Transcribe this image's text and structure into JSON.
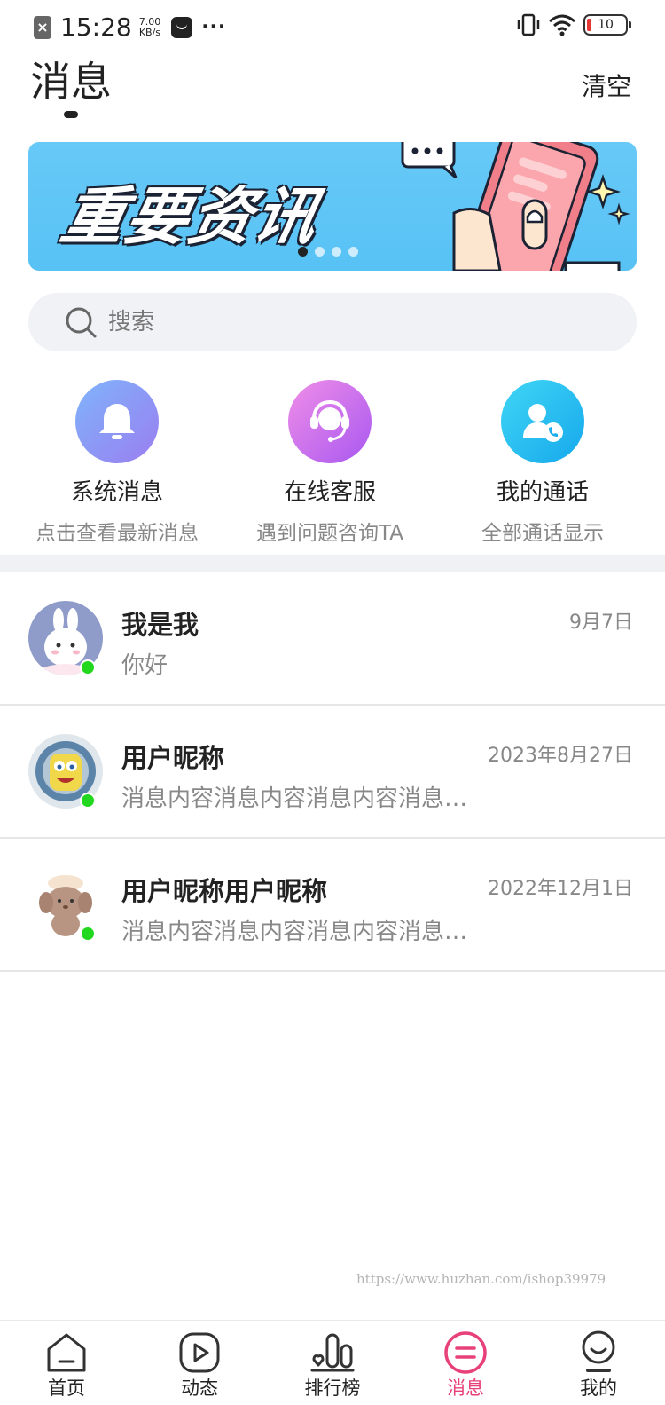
{
  "status_bar": {
    "time": "15:28",
    "speed_value": "7.00",
    "speed_unit": "KB/s",
    "battery": "10"
  },
  "header": {
    "title": "消息",
    "clear_label": "清空"
  },
  "banner": {
    "text": "重要资讯",
    "slides": 4,
    "active_slide": 1
  },
  "search": {
    "placeholder": "搜索"
  },
  "quick_actions": [
    {
      "title": "系统消息",
      "subtitle": "点击查看最新消息",
      "icon": "bell-icon",
      "color": "#8a8ff5"
    },
    {
      "title": "在线客服",
      "subtitle": "遇到问题咨询TA",
      "icon": "headset-icon",
      "color": "#c571f0"
    },
    {
      "title": "我的通话",
      "subtitle": "全部通话显示",
      "icon": "contact-call-icon",
      "color": "#28c0f0"
    }
  ],
  "messages": [
    {
      "name": "我是我",
      "time": "9月7日",
      "preview": "你好",
      "online": true
    },
    {
      "name": "用户昵称",
      "time": "2023年8月27日",
      "preview": "消息内容消息内容消息内容消息内容消息内容",
      "online": true
    },
    {
      "name": "用户昵称用户昵称",
      "time": "2022年12月1日",
      "preview": "消息内容消息内容消息内容消息内容消息内容",
      "online": true
    }
  ],
  "watermark": "https://www.huzhan.com/ishop39979",
  "tabbar": {
    "tabs": [
      {
        "label": "首页",
        "icon": "home-icon"
      },
      {
        "label": "动态",
        "icon": "play-icon"
      },
      {
        "label": "排行榜",
        "icon": "ranking-icon"
      },
      {
        "label": "消息",
        "icon": "message-icon",
        "active": true
      },
      {
        "label": "我的",
        "icon": "profile-icon"
      }
    ]
  },
  "colors": {
    "accent": "#e8407a",
    "online": "#22d81f",
    "banner": "#5ec6f6"
  }
}
